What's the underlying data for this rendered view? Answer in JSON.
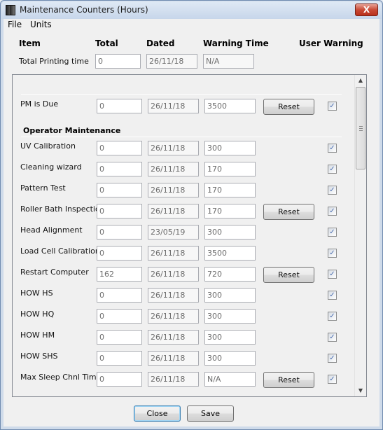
{
  "window": {
    "title": "Maintenance Counters (Hours)",
    "close_glyph": "X"
  },
  "menu": [
    {
      "label": "File"
    },
    {
      "label": "Units"
    }
  ],
  "headers": {
    "item": "Item",
    "total": "Total",
    "dated": "Dated",
    "warning": "Warning Time",
    "user_warning": "User Warning"
  },
  "top_row": {
    "label": "Total Printing time",
    "total": "0",
    "dated": "26/11/18",
    "warning": "N/A"
  },
  "section_title": "Operator Maintenance",
  "reset_label": "Reset",
  "rows": [
    {
      "label": "PM is Due",
      "total": "0",
      "dated": "26/11/18",
      "warning": "3500",
      "reset": true,
      "checked": true
    },
    {
      "label": "UV Calibration",
      "total": "0",
      "dated": "26/11/18",
      "warning": "300",
      "reset": false,
      "checked": true
    },
    {
      "label": "Cleaning wizard",
      "total": "0",
      "dated": "26/11/18",
      "warning": "170",
      "reset": false,
      "checked": true
    },
    {
      "label": "Pattern Test",
      "total": "0",
      "dated": "26/11/18",
      "warning": "170",
      "reset": false,
      "checked": true
    },
    {
      "label": "Roller Bath Inspection",
      "total": "0",
      "dated": "26/11/18",
      "warning": "170",
      "reset": true,
      "checked": true
    },
    {
      "label": "Head Alignment",
      "total": "0",
      "dated": "23/05/19",
      "warning": "300",
      "reset": false,
      "checked": true
    },
    {
      "label": "Load Cell Calibration",
      "total": "0",
      "dated": "26/11/18",
      "warning": "3500",
      "reset": false,
      "checked": true
    },
    {
      "label": "Restart Computer",
      "total": "162",
      "dated": "26/11/18",
      "warning": "720",
      "reset": true,
      "checked": true
    },
    {
      "label": "HOW HS",
      "total": "0",
      "dated": "26/11/18",
      "warning": "300",
      "reset": false,
      "checked": true
    },
    {
      "label": "HOW HQ",
      "total": "0",
      "dated": "26/11/18",
      "warning": "300",
      "reset": false,
      "checked": true
    },
    {
      "label": "HOW HM",
      "total": "0",
      "dated": "26/11/18",
      "warning": "300",
      "reset": false,
      "checked": true
    },
    {
      "label": "HOW SHS",
      "total": "0",
      "dated": "26/11/18",
      "warning": "300",
      "reset": false,
      "checked": true
    },
    {
      "label": "Max Sleep Chnl Time",
      "total": "0",
      "dated": "26/11/18",
      "warning": "N/A",
      "reset": true,
      "checked": true
    }
  ],
  "footer": {
    "close_label": "Close",
    "save_label": "Save"
  },
  "checkmark": "✓"
}
